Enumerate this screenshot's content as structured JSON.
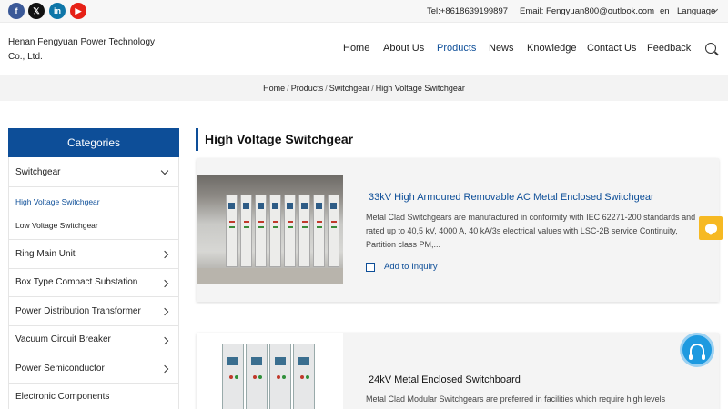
{
  "social": [
    {
      "name": "facebook",
      "glyph": "f"
    },
    {
      "name": "x",
      "glyph": "𝕏"
    },
    {
      "name": "linkedin",
      "glyph": "in"
    },
    {
      "name": "youtube",
      "glyph": "▶"
    }
  ],
  "topbar": {
    "tel": "Tel:+8618639199897",
    "email": "Email: Fengyuan800@outlook.com",
    "lang_code": "en",
    "lang_label": "Language"
  },
  "header": {
    "company": "Henan Fengyuan Power Technology Co., Ltd.",
    "nav": [
      "Home",
      "About Us",
      "Products",
      "News",
      "Knowledge",
      "Contact Us",
      "Feedback"
    ]
  },
  "breadcrumb": [
    "Home",
    "Products",
    "Switchgear",
    "High Voltage Switchgear"
  ],
  "sidebar": {
    "title": "Categories",
    "items": [
      {
        "label": "Switchgear",
        "expanded": true,
        "children": [
          "High Voltage Switchgear",
          "Low Voltage Switchgear"
        ]
      },
      {
        "label": "Ring Main Unit"
      },
      {
        "label": "Box Type Compact Substation"
      },
      {
        "label": "Power Distribution Transformer"
      },
      {
        "label": "Vacuum Circuit Breaker"
      },
      {
        "label": "Power Semiconductor"
      },
      {
        "label": "Electronic Components"
      }
    ]
  },
  "main": {
    "title": "High Voltage Switchgear",
    "products": [
      {
        "title": "33kV High Armoured Removable AC Metal Enclosed Switchgear",
        "desc": "Metal Clad Switchgears are manufactured in conformity with IEC 62271-200 standards and rated up to 40,5 kV, 4000 A, 40 kA/3s electrical values with LSC-2B service Continuity, Partition class PM,...",
        "inquiry": "Add to Inquiry"
      },
      {
        "title": "24kV Metal Enclosed Switchboard",
        "desc": "Metal Clad Modular Switchgears are preferred in facilities which require high levels"
      }
    ]
  },
  "colors": {
    "accent": "#0d4e98",
    "chat": "#f6b923",
    "support": "#1e9ae0"
  }
}
